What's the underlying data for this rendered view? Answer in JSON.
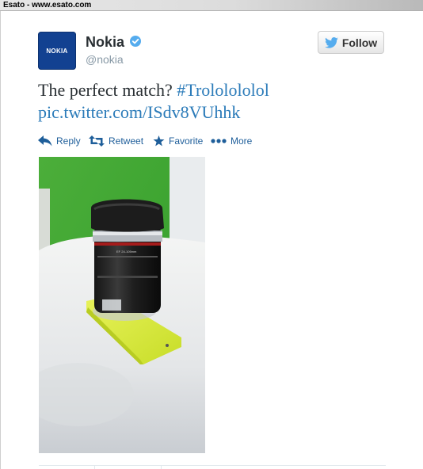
{
  "window": {
    "title": "Esato - www.esato.com"
  },
  "account": {
    "display_name": "Nokia",
    "screen_name": "@nokia",
    "avatar_logo": "NOKIA",
    "verified": true
  },
  "follow_button": {
    "label": "Follow",
    "icon": "twitter-bird-icon"
  },
  "tweet": {
    "text": "The perfect match?",
    "hashtag": "#Trololololol",
    "link": "pic.twitter.com/ISdv8VUhhk"
  },
  "actions": [
    {
      "label": "Reply",
      "icon": "reply-icon"
    },
    {
      "label": "Retweet",
      "icon": "retweet-icon"
    },
    {
      "label": "Favorite",
      "icon": "star-icon"
    },
    {
      "label": "More",
      "icon": "more-dots-icon"
    }
  ],
  "colors": {
    "brand_blue": "#124191",
    "link_blue": "#2b7bb9",
    "action_blue": "#1e5e9a",
    "verified_blue": "#55acee",
    "phone_yellow": "#d9ea3c",
    "wall_green": "#35a82c"
  }
}
